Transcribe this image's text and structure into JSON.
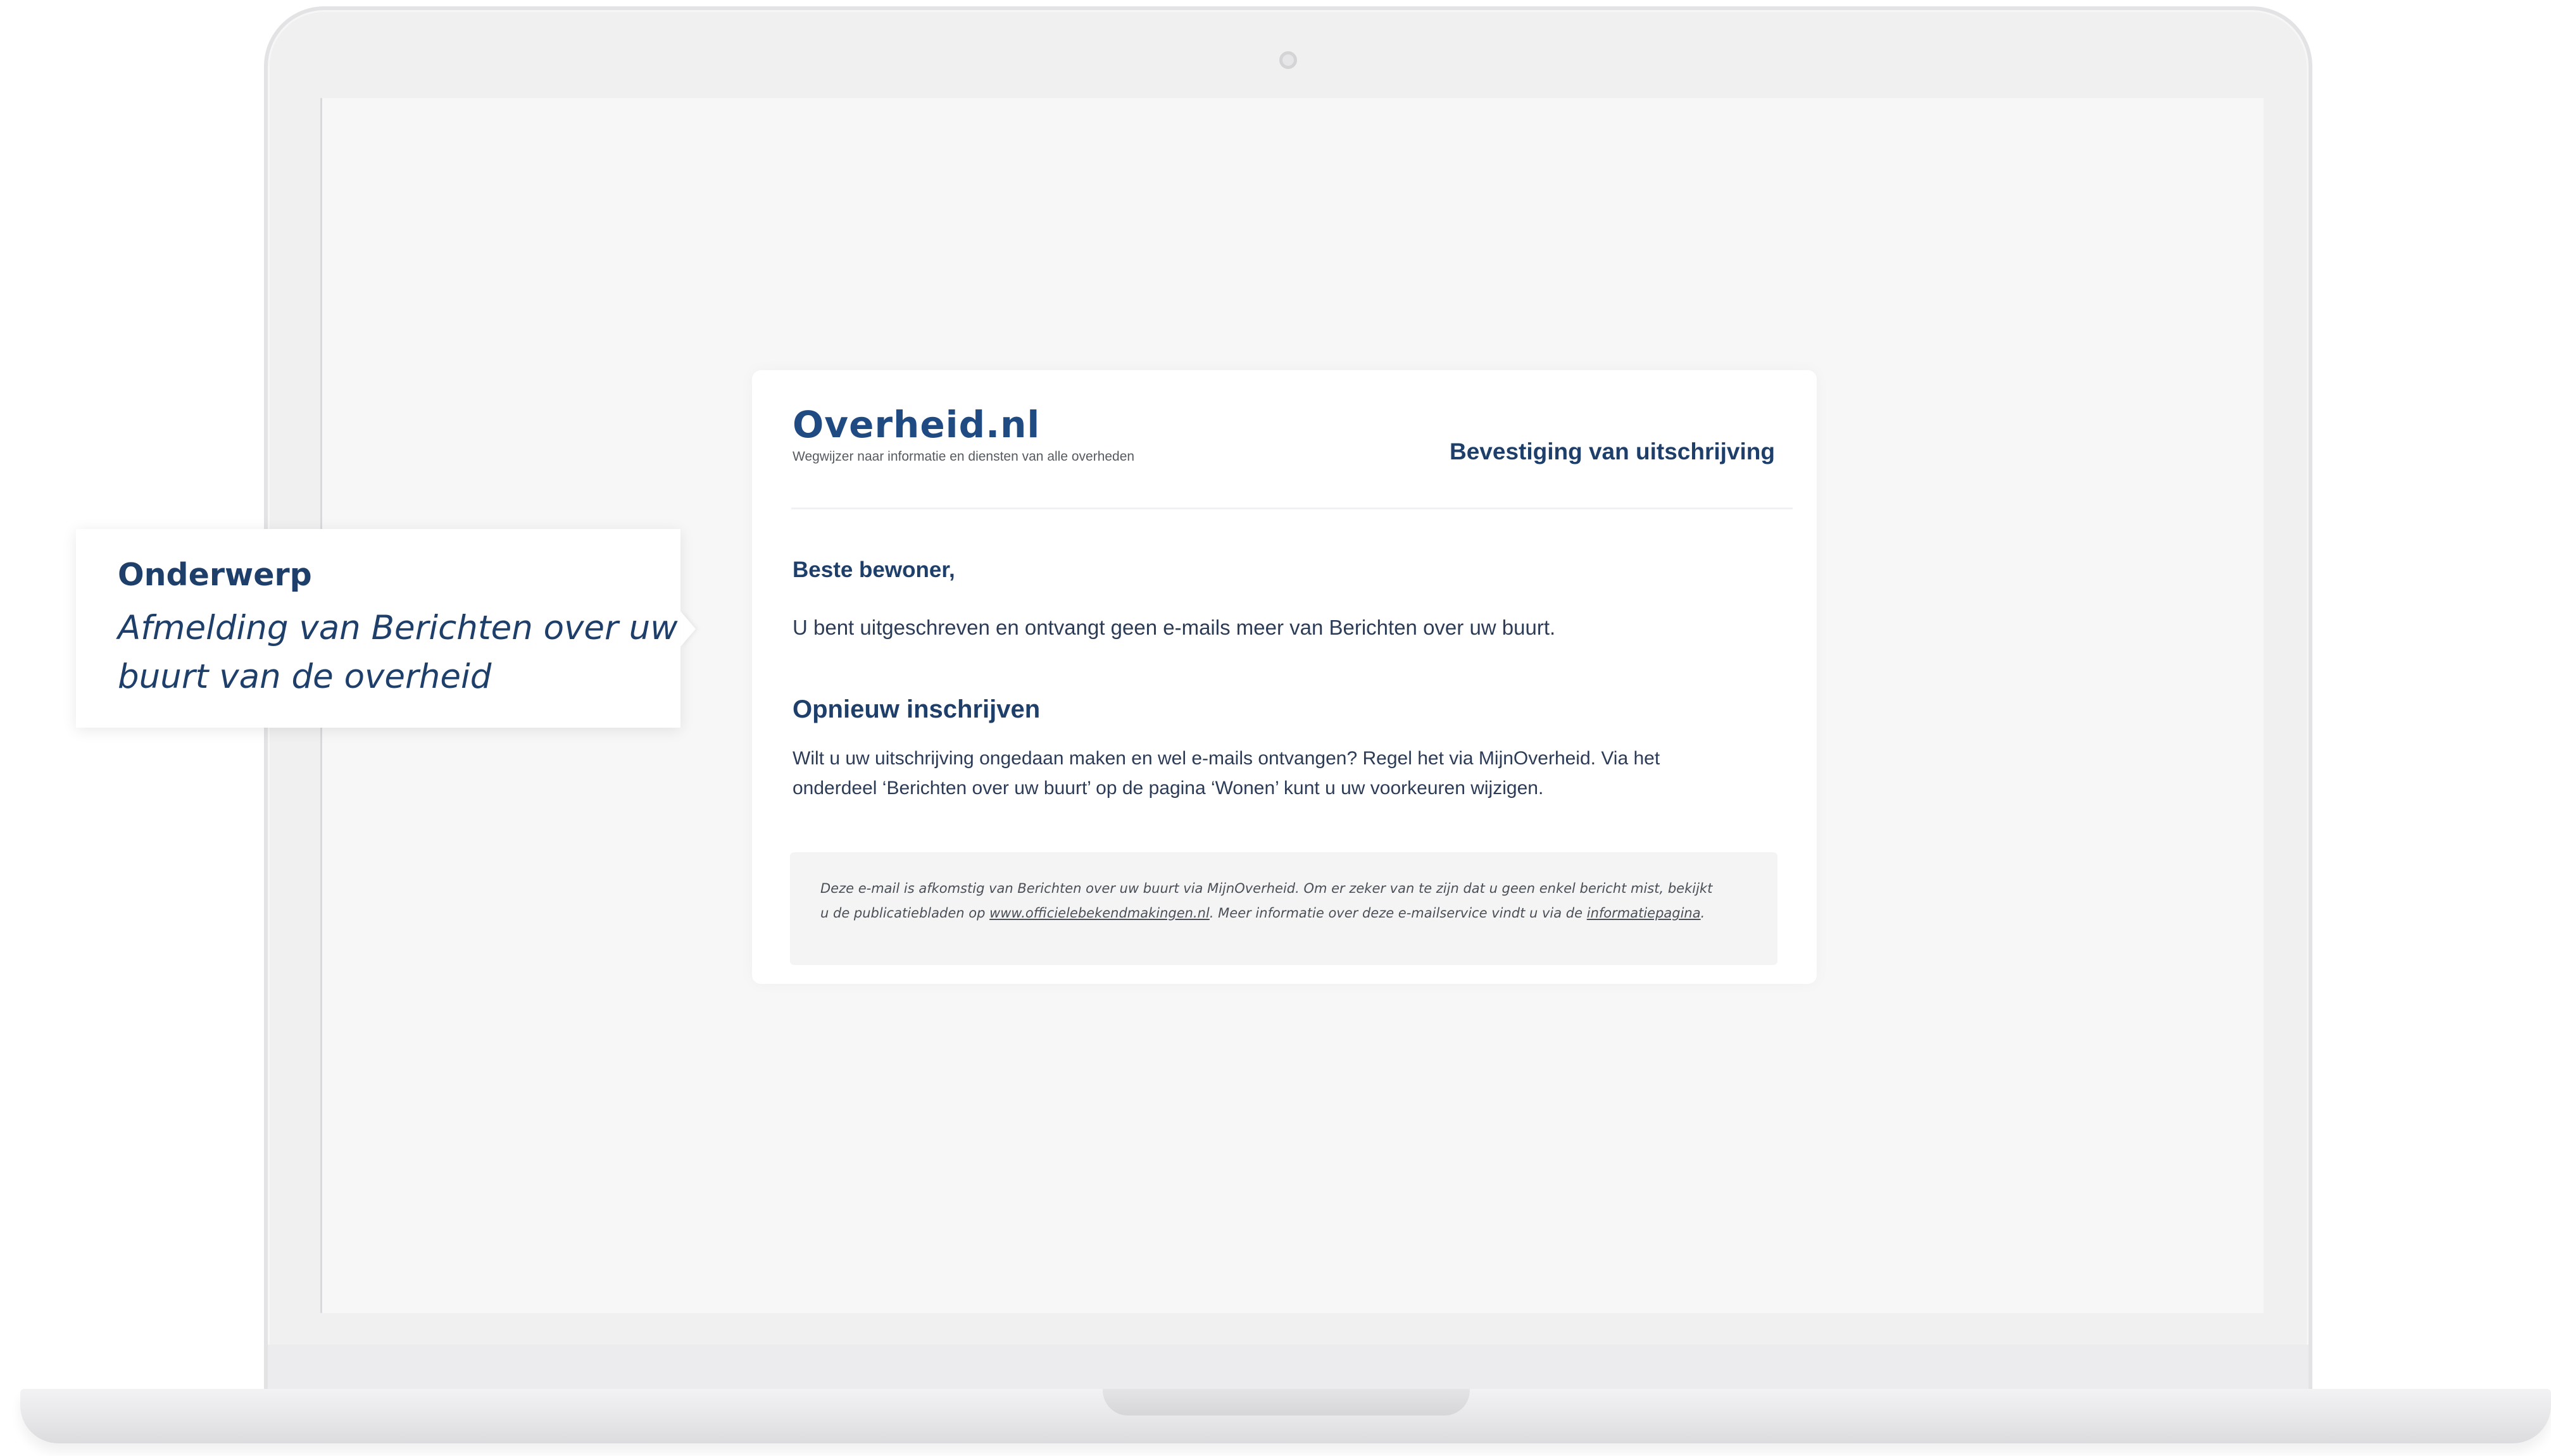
{
  "callout": {
    "label": "Onderwerp",
    "value_line1": "Afmelding van Berichten over uw",
    "value_line2": "buurt van de overheid"
  },
  "email": {
    "logo": {
      "text": "Overheid.nl",
      "tagline": "Wegwijzer naar informatie en diensten van alle overheden"
    },
    "header_title": "Bevestiging van uitschrijving",
    "greeting": "Beste bewoner,",
    "paragraph1": "U bent uitgeschreven en ontvangt geen e-mails meer van Berichten over uw buurt.",
    "section_title": "Opnieuw inschrijven",
    "paragraph2_line1": "Wilt u uw uitschrijving ongedaan maken en wel e-mails ontvangen? Regel het via MijnOverheid. Via het",
    "paragraph2_line2": "onderdeel ‘Berichten over uw buurt’ op de pagina ‘Wonen’ kunt u uw voorkeuren wijzigen.",
    "footer": {
      "line1": "Deze e-mail is afkomstig van Berichten over uw buurt via MijnOverheid. Om er zeker van te zijn dat u geen enkel bericht mist, bekijkt",
      "line2_prefix": "u de publicatiebladen op ",
      "link1": "www.officielebekendmakingen.nl",
      "line2_middle": ". Meer informatie over deze e-mailservice vindt u via de ",
      "link2": "informatiepagina",
      "line2_suffix": "."
    }
  },
  "colors": {
    "brand_blue": "#1f4a82",
    "heading_blue": "#1f3f6b",
    "logo_accent": "#e87722"
  },
  "icons": {
    "logo_mark": "overheid-logo-mark-icon"
  }
}
